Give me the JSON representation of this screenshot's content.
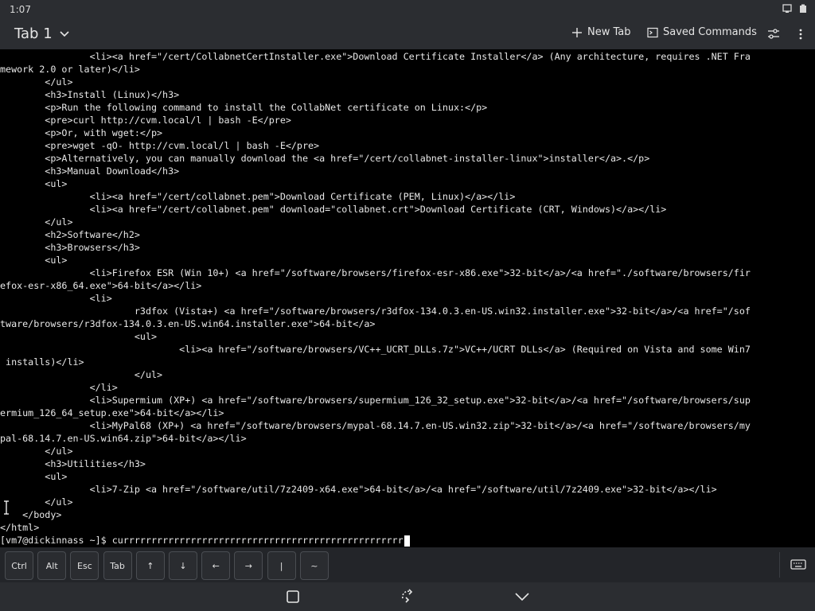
{
  "statusbar": {
    "time": "1:07"
  },
  "header": {
    "tab_label": "Tab 1",
    "new_tab_label": "New Tab",
    "saved_commands_label": "Saved Commands"
  },
  "terminal": {
    "lines": [
      "                <li><a href=\"/cert/CollabnetCertInstaller.exe\">Download Certificate Installer</a> (Any architecture, requires .NET Fra",
      "mework 2.0 or later)</li>",
      "        </ul>",
      "        <h3>Install (Linux)</h3>",
      "        <p>Run the following command to install the CollabNet certificate on Linux:</p>",
      "        <pre>curl http://cvm.local/l | bash -E</pre>",
      "        <p>Or, with wget:</p>",
      "        <pre>wget -qO- http://cvm.local/l | bash -E</pre>",
      "        <p>Alternatively, you can manually download the <a href=\"/cert/collabnet-installer-linux\">installer</a>.</p>",
      "        <h3>Manual Download</h3>",
      "        <ul>",
      "                <li><a href=\"/cert/collabnet.pem\">Download Certificate (PEM, Linux)</a></li>",
      "                <li><a href=\"/cert/collabnet.pem\" download=\"collabnet.crt\">Download Certificate (CRT, Windows)</a></li>",
      "        </ul>",
      "        <h2>Software</h2>",
      "        <h3>Browsers</h3>",
      "        <ul>",
      "                <li>Firefox ESR (Win 10+) <a href=\"/software/browsers/firefox-esr-x86.exe\">32-bit</a>/<a href=\"./software/browsers/fir",
      "efox-esr-x86_64.exe\">64-bit</a></li>",
      "                <li>",
      "                        r3dfox (Vista+) <a href=\"/software/browsers/r3dfox-134.0.3.en-US.win32.installer.exe\">32-bit</a>/<a href=\"/sof",
      "tware/browsers/r3dfox-134.0.3.en-US.win64.installer.exe\">64-bit</a>",
      "                        <ul>",
      "                                <li><a href=\"/software/browsers/VC++_UCRT_DLLs.7z\">VC++/UCRT DLLs</a> (Required on Vista and some Win7",
      " installs)</li>",
      "                        </ul>",
      "                </li>",
      "                <li>Supermium (XP+) <a href=\"/software/browsers/supermium_126_32_setup.exe\">32-bit</a>/<a href=\"/software/browsers/sup",
      "ermium_126_64_setup.exe\">64-bit</a></li>",
      "                <li>MyPal68 (XP+) <a href=\"/software/browsers/mypal-68.14.7.en-US.win32.zip\">32-bit</a>/<a href=\"/software/browsers/my",
      "pal-68.14.7.en-US.win64.zip\">64-bit</a></li>",
      "        </ul>",
      "        <h3>Utilities</h3>",
      "        <ul>",
      "                <li>7-Zip <a href=\"/software/util/7z2409-x64.exe\">64-bit</a>/<a href=\"/software/util/7z2409.exe\">32-bit</a></li>",
      "        </ul>",
      "    </body>",
      "</html>"
    ],
    "prompt": "[vm7@dickinnass ~]$ ",
    "command": "currrrrrrrrrrrrrrrrrrrrrrrrrrrrrrrrrrrrrrrrrrrrrrrrr"
  },
  "keys": [
    {
      "label": "Ctrl",
      "name": "key-ctrl"
    },
    {
      "label": "Alt",
      "name": "key-alt"
    },
    {
      "label": "Esc",
      "name": "key-esc"
    },
    {
      "label": "Tab",
      "name": "key-tab"
    },
    {
      "label": "↑",
      "name": "key-up"
    },
    {
      "label": "↓",
      "name": "key-down"
    },
    {
      "label": "←",
      "name": "key-left"
    },
    {
      "label": "→",
      "name": "key-right"
    },
    {
      "label": "|",
      "name": "key-pipe"
    },
    {
      "label": "~",
      "name": "key-tilde"
    }
  ],
  "icons": {
    "plus": "plus-icon",
    "saved": "terminal-icon",
    "settings": "sliders-icon",
    "menu": "more-vertical-icon",
    "keyboard": "keyboard-icon",
    "home": "square-icon",
    "rotate": "rotate-icon",
    "hide": "chevron-down-icon"
  }
}
